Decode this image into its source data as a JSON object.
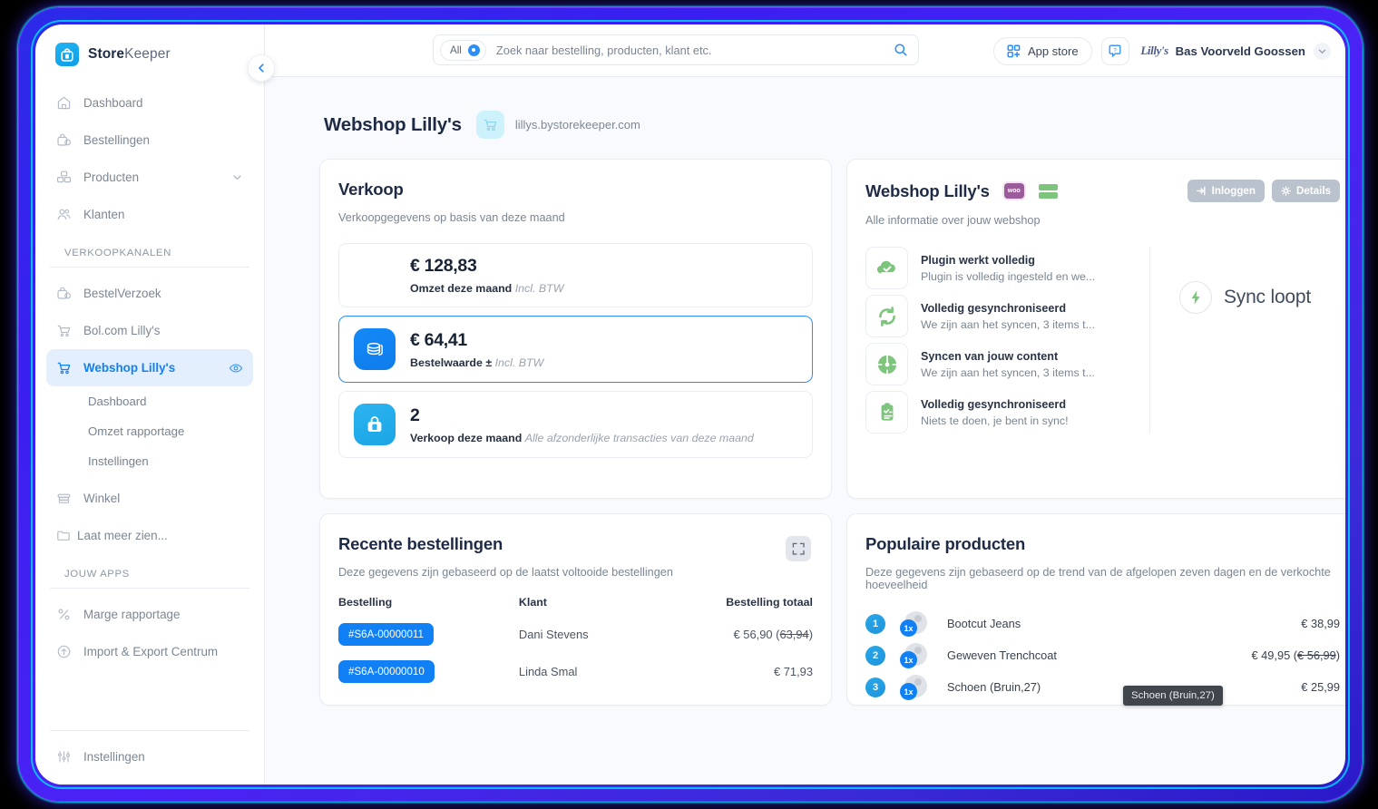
{
  "brand": {
    "bold": "Store",
    "light": "Keeper",
    "logo_icon": "shopping-bag-icon"
  },
  "topbar": {
    "collapse_icon": "chevron-left-icon",
    "search": {
      "scope_label": "All",
      "placeholder": "Zoek naar bestelling, producten, klant etc.",
      "value": "",
      "search_icon": "search-icon",
      "clear_icon": "clear-circle-icon"
    },
    "appstore_label": "App store",
    "appstore_icon": "grid-plus-icon",
    "help_icon": "question-chat-icon",
    "user_name": "Bas Voorveld Goossen",
    "user_avatar_text": "Lilly's",
    "user_caret_icon": "chevron-down-icon"
  },
  "sidebar": {
    "items": [
      {
        "label": "Dashboard",
        "icon": "home-icon"
      },
      {
        "label": "Bestellingen",
        "icon": "order-bag-icon"
      },
      {
        "label": "Producten",
        "icon": "products-box-icon",
        "trailing_icon": "chevron-down-icon"
      },
      {
        "label": "Klanten",
        "icon": "users-icon"
      }
    ],
    "section_sales_channels": "VERKOOPKANALEN",
    "channels": [
      {
        "label": "BestelVerzoek",
        "icon": "order-bag-icon",
        "active": false
      },
      {
        "label": "Bol.com Lilly's",
        "icon": "cart-icon",
        "active": false
      },
      {
        "label": "Webshop Lilly's",
        "icon": "cart-icon",
        "active": true,
        "trailing_icon": "eye-icon"
      }
    ],
    "channel_subitems": [
      "Dashboard",
      "Omzet rapportage",
      "Instellingen"
    ],
    "after_channels": [
      {
        "label": "Winkel",
        "icon": "store-icon"
      },
      {
        "label": "Laat meer zien...",
        "icon": "folder-icon"
      }
    ],
    "section_your_apps": "JOUW APPS",
    "apps": [
      {
        "label": "Marge rapportage",
        "icon": "percent-icon"
      },
      {
        "label": "Import & Export Centrum",
        "icon": "cloud-upload-icon"
      }
    ],
    "bottom": {
      "label": "Instellingen",
      "icon": "settings-sliders-icon"
    }
  },
  "page": {
    "title": "Webshop Lilly's",
    "url": "lillys.bystorekeeper.com",
    "url_icon": "cart-icon"
  },
  "verkoop": {
    "title": "Verkoop",
    "subtitle": "Verkoopgegevens op basis van deze maand",
    "stats": [
      {
        "value": "€ 128,83",
        "label": "Omzet deze maand",
        "note": "Incl. BTW",
        "icon": null,
        "selected": false
      },
      {
        "value": "€ 64,41",
        "label": "Bestelwaarde ±",
        "note": "Incl. BTW",
        "icon": "coins-icon",
        "selected": true
      },
      {
        "value": "2",
        "label": "Verkoop deze maand",
        "note": "Alle afzonderlijke transacties van deze maand",
        "icon": "shopping-bag-icon",
        "selected": false
      }
    ]
  },
  "webshop": {
    "title": "Webshop Lilly's",
    "subtitle": "Alle informatie over jouw webshop",
    "badges": [
      {
        "name": "woocommerce-badge",
        "text": "woo"
      },
      {
        "name": "database-badge",
        "text": ""
      }
    ],
    "login_label": "Inloggen",
    "login_icon": "login-arrow-icon",
    "details_label": "Details",
    "details_icon": "gear-icon",
    "sync_items": [
      {
        "title": "Plugin werkt volledig",
        "desc": "Plugin is volledig ingesteld en we...",
        "icon": "cloud-check-icon"
      },
      {
        "title": "Volledig gesynchroniseerd",
        "desc": "We zijn aan het syncen, 3 items t...",
        "icon": "sync-arrows-icon"
      },
      {
        "title": "Syncen van jouw content",
        "desc": "We zijn aan het syncen, 3 items t...",
        "icon": "gauge-icon"
      },
      {
        "title": "Volledig gesynchroniseerd",
        "desc": "Niets te doen, je bent in sync!",
        "icon": "clipboard-check-icon"
      }
    ],
    "sync_status_text": "Sync loopt",
    "sync_status_icon": "lightning-icon"
  },
  "recent_orders": {
    "title": "Recente bestellingen",
    "subtitle": "Deze gegevens zijn gebaseerd op de laatst voltooide bestellingen",
    "expand_icon": "expand-icon",
    "columns": [
      "Bestelling",
      "Klant",
      "Bestelling totaal"
    ],
    "rows": [
      {
        "order": "#S6A-00000011",
        "customer": "Dani Stevens",
        "total": "€ 56,90",
        "total_original": "63,94"
      },
      {
        "order": "#S6A-00000010",
        "customer": "Linda Smal",
        "total": "€ 71,93",
        "total_original": ""
      }
    ]
  },
  "popular_products": {
    "title": "Populaire producten",
    "subtitle": "Deze gegevens zijn gebaseerd op de trend van de afgelopen zeven dagen en de verkochte hoeveelheid",
    "rows": [
      {
        "rank": "1",
        "qty": "1x",
        "name": "Bootcut Jeans",
        "price": "€ 38,99",
        "price_original": ""
      },
      {
        "rank": "2",
        "qty": "1x",
        "name": "Geweven Trenchcoat",
        "price": "€ 49,95",
        "price_original": "€ 56,99"
      },
      {
        "rank": "3",
        "qty": "1x",
        "name": "Schoen (Bruin,27)",
        "price": "€ 25,99",
        "price_original": ""
      }
    ],
    "tooltip": "Schoen (Bruin,27)"
  },
  "colors": {
    "accent_blue": "#1180f5",
    "accent_cyan": "#2cb4ef",
    "sidebar_active_bg": "#e3effd",
    "green": "#7dc47d",
    "frame_purple": "#3b1ff0",
    "text_dark": "#1f2b45"
  }
}
